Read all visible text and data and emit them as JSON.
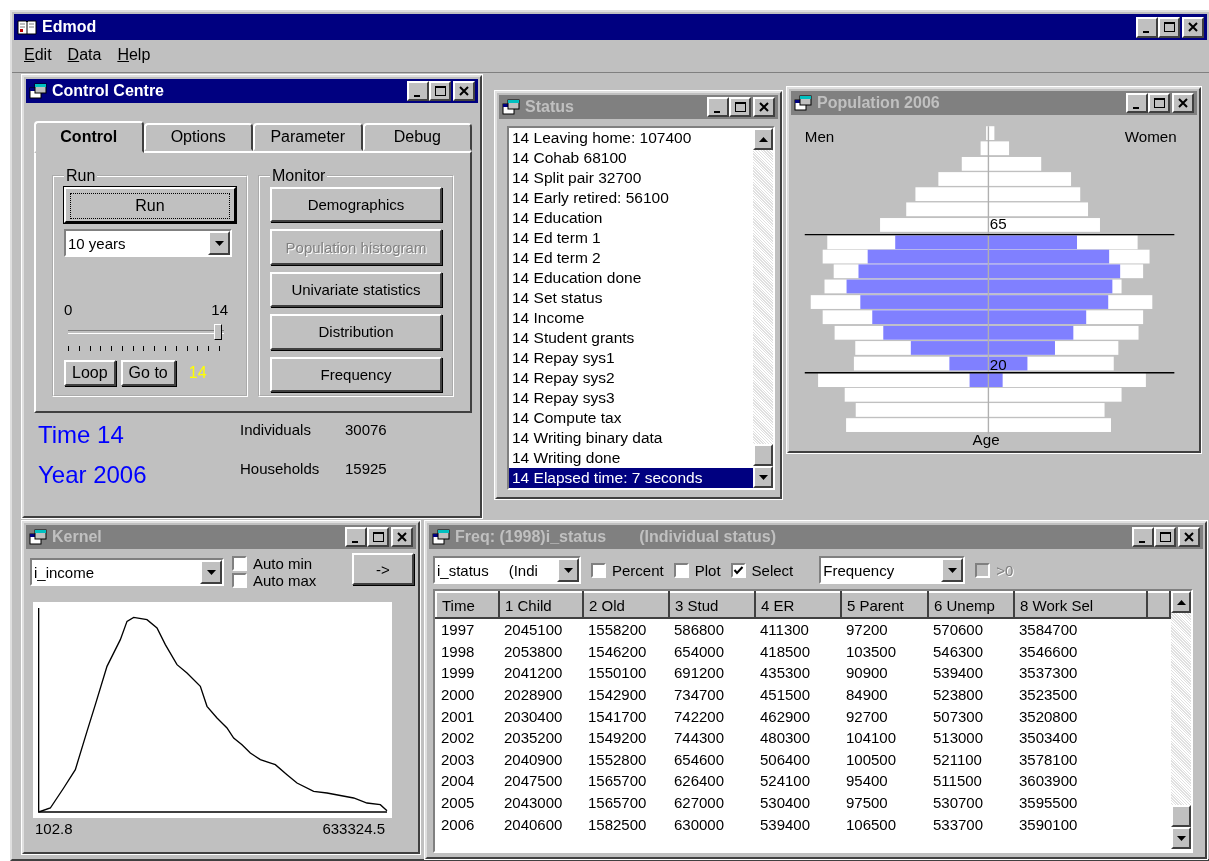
{
  "app": {
    "title": "Edmod",
    "active": true
  },
  "menu": [
    {
      "label": "Edit"
    },
    {
      "label": "Data"
    },
    {
      "label": "Help"
    }
  ],
  "control_centre": {
    "title": "Control Centre",
    "active": true,
    "tabs": [
      {
        "label": "Control",
        "selected": true
      },
      {
        "label": "Options",
        "selected": false
      },
      {
        "label": "Parameter",
        "selected": false
      },
      {
        "label": "Debug",
        "selected": false
      }
    ],
    "run_group": {
      "label": "Run",
      "run_button": "Run",
      "period": "10 years",
      "slider": {
        "min": "0",
        "max": "14",
        "level": 1
      },
      "loop_button": "Loop",
      "goto_button": "Go to",
      "current": "14"
    },
    "monitor_group": {
      "label": "Monitor",
      "buttons": [
        {
          "label": "Demographics",
          "disabled": false
        },
        {
          "label": "Population histogram",
          "disabled": true
        },
        {
          "label": "Univariate statistics",
          "disabled": false
        },
        {
          "label": "Distribution",
          "disabled": false
        },
        {
          "label": "Frequency",
          "disabled": false
        }
      ]
    },
    "time": "Time 14",
    "year": "Year 2006",
    "counts": [
      {
        "label": "Individuals",
        "value": "30076"
      },
      {
        "label": "Households",
        "value": "15925"
      }
    ]
  },
  "status": {
    "title": "Status",
    "active": false,
    "items": [
      {
        "text": "14 Leaving home: 107400",
        "selected": false
      },
      {
        "text": "14 Cohab 68100",
        "selected": false
      },
      {
        "text": "14 Split pair 32700",
        "selected": false
      },
      {
        "text": "14 Early retired: 56100",
        "selected": false
      },
      {
        "text": "14 Education",
        "selected": false
      },
      {
        "text": "14 Ed term 1",
        "selected": false
      },
      {
        "text": "14 Ed term 2",
        "selected": false
      },
      {
        "text": "14 Education done",
        "selected": false
      },
      {
        "text": "14 Set status",
        "selected": false
      },
      {
        "text": "14 Income",
        "selected": false
      },
      {
        "text": "14 Student grants",
        "selected": false
      },
      {
        "text": "14 Repay sys1",
        "selected": false
      },
      {
        "text": "14 Repay sys2",
        "selected": false
      },
      {
        "text": "14 Repay sys3",
        "selected": false
      },
      {
        "text": "14 Compute tax",
        "selected": false
      },
      {
        "text": "14 Writing binary data",
        "selected": false
      },
      {
        "text": "14 Writing done",
        "selected": false
      },
      {
        "text": "14 Elapsed time: 7 seconds",
        "selected": true
      }
    ]
  },
  "population": {
    "title": "Population 2006",
    "active": false,
    "left_label": "Men",
    "right_label": "Women",
    "upper_marker": "65",
    "lower_marker": "20",
    "axis_label": "Age"
  },
  "kernel": {
    "title": "Kernel",
    "active": false,
    "variable": "i_income",
    "checkboxes": [
      {
        "label": "Auto min",
        "checked": false
      },
      {
        "label": "Auto max",
        "checked": false
      }
    ],
    "go_button": "->",
    "x_min": "102.8",
    "x_max": "633324.5"
  },
  "freq": {
    "title": "Freq: (1998)i_status",
    "subtitle": "(Individual status)",
    "active": false,
    "variable": "i_status",
    "variable_note": "(Indi",
    "options": [
      {
        "label": "Percent",
        "checked": false
      },
      {
        "label": "Plot",
        "checked": false
      },
      {
        "label": "Select",
        "checked": true
      }
    ],
    "measure": "Frequency",
    "nonzero": {
      "label": ">0",
      "checked": false,
      "disabled": true
    },
    "table": {
      "columns": [
        "Time",
        "1 Child",
        "2 Old",
        "3 Stud",
        "4 ER",
        "5 Parent",
        "6 Unemp",
        "8 Work Sel"
      ],
      "rows": [
        [
          "1997",
          "2045100",
          "1558200",
          "586800",
          "411300",
          "97200",
          "570600",
          "3584700"
        ],
        [
          "1998",
          "2053800",
          "1546200",
          "654000",
          "418500",
          "103500",
          "546300",
          "3546600"
        ],
        [
          "1999",
          "2041200",
          "1550100",
          "691200",
          "435300",
          "90900",
          "539400",
          "3537300"
        ],
        [
          "2000",
          "2028900",
          "1542900",
          "734700",
          "451500",
          "84900",
          "523800",
          "3523500"
        ],
        [
          "2001",
          "2030400",
          "1541700",
          "742200",
          "462900",
          "92700",
          "507300",
          "3520800"
        ],
        [
          "2002",
          "2035200",
          "1549200",
          "744300",
          "480300",
          "104100",
          "513000",
          "3503400"
        ],
        [
          "2003",
          "2040900",
          "1552800",
          "654600",
          "506400",
          "100500",
          "521100",
          "3578100"
        ],
        [
          "2004",
          "2047500",
          "1565700",
          "626400",
          "524100",
          "95400",
          "511500",
          "3603900"
        ],
        [
          "2005",
          "2043000",
          "1565700",
          "627000",
          "530400",
          "97500",
          "530700",
          "3595500"
        ],
        [
          "2006",
          "2040600",
          "1582500",
          "630000",
          "539400",
          "106500",
          "533700",
          "3590100"
        ]
      ]
    }
  }
}
